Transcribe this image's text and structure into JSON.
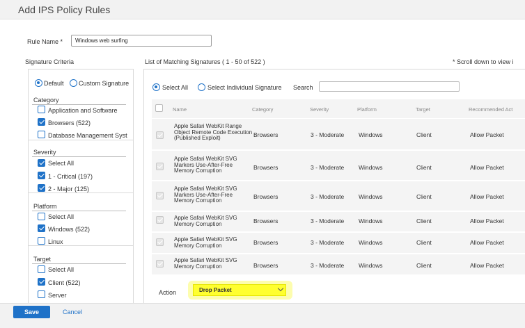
{
  "dialog": {
    "title": "Add IPS Policy Rules"
  },
  "rule": {
    "name_label": "Rule Name *",
    "name_value": "Windows web surfing"
  },
  "signature_criteria": {
    "label": "Signature Criteria",
    "mode_default": "Default",
    "mode_custom": "Custom Signature",
    "groups": {
      "category": {
        "title": "Category",
        "items": [
          {
            "label": "Application and Software",
            "checked": false
          },
          {
            "label": "Browsers (522)",
            "checked": true
          },
          {
            "label": "Database Management Syst",
            "checked": false
          }
        ]
      },
      "severity": {
        "title": "Severity",
        "items": [
          {
            "label": "Select All",
            "checked": true
          },
          {
            "label": "1 - Critical (197)",
            "checked": true
          },
          {
            "label": "2 - Major (125)",
            "checked": true
          }
        ]
      },
      "platform": {
        "title": "Platform",
        "items": [
          {
            "label": "Select All",
            "checked": false
          },
          {
            "label": "Windows (522)",
            "checked": true
          },
          {
            "label": "Linux",
            "checked": false
          }
        ]
      },
      "target": {
        "title": "Target",
        "items": [
          {
            "label": "Select All",
            "checked": false
          },
          {
            "label": "Client (522)",
            "checked": true
          },
          {
            "label": "Server",
            "checked": false
          }
        ]
      }
    }
  },
  "matching": {
    "label": "List of Matching Signatures ( 1 - 50 of 522 )",
    "scroll_hint": "* Scroll down to view i",
    "select_all": "Select All",
    "select_individual": "Select Individual Signature",
    "search_label": "Search",
    "columns": [
      "Name",
      "Category",
      "Severity",
      "Platform",
      "Target",
      "Recommended Act"
    ],
    "rows": [
      {
        "name": "Apple Safari WebKit Range Object Remote Code Execution (Published Exploit)",
        "category": "Browsers",
        "severity": "3 - Moderate",
        "platform": "Windows",
        "target": "Client",
        "action": "Allow Packet"
      },
      {
        "name": "Apple Safari WebKit SVG Markers Use-After-Free Memory Corruption",
        "category": "Browsers",
        "severity": "3 - Moderate",
        "platform": "Windows",
        "target": "Client",
        "action": "Allow Packet"
      },
      {
        "name": "Apple Safari WebKit SVG Markers Use-After-Free Memory Corruption",
        "category": "Browsers",
        "severity": "3 - Moderate",
        "platform": "Windows",
        "target": "Client",
        "action": "Allow Packet"
      },
      {
        "name": "Apple Safari WebKit SVG Memory Corruption",
        "category": "Browsers",
        "severity": "3 - Moderate",
        "platform": "Windows",
        "target": "Client",
        "action": "Allow Packet"
      },
      {
        "name": "Apple Safari WebKit SVG Memory Corruption",
        "category": "Browsers",
        "severity": "3 - Moderate",
        "platform": "Windows",
        "target": "Client",
        "action": "Allow Packet"
      },
      {
        "name": "Apple Safari WebKit SVG Memory Corruption",
        "category": "Browsers",
        "severity": "3 - Moderate",
        "platform": "Windows",
        "target": "Client",
        "action": "Allow Packet"
      }
    ]
  },
  "action": {
    "label": "Action",
    "selected": "Drop Packet"
  },
  "footer": {
    "save": "Save",
    "cancel": "Cancel"
  },
  "colors": {
    "accent": "#1f72c8",
    "highlight": "#ffff2f"
  }
}
